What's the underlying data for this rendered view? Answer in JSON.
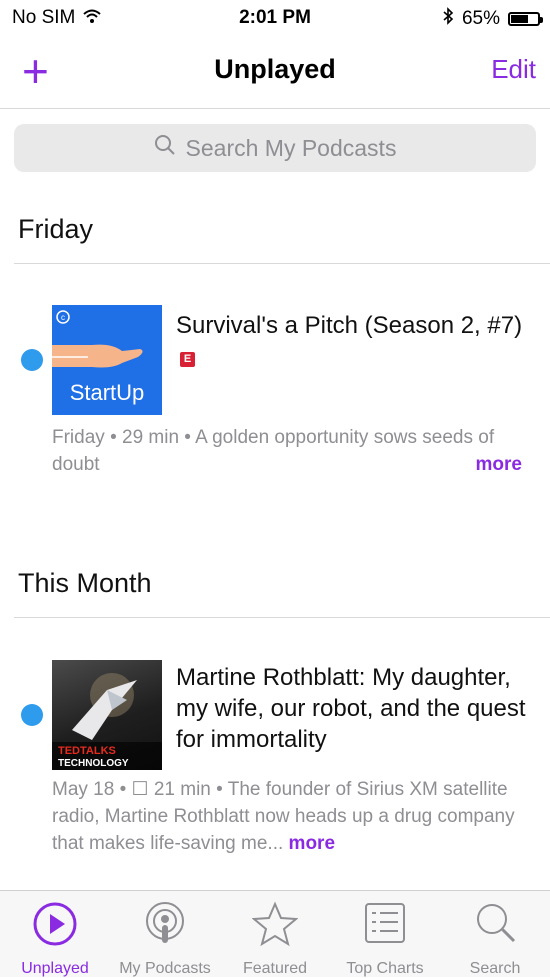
{
  "status_bar": {
    "carrier": "No SIM",
    "time": "2:01 PM",
    "battery_percent": "65%",
    "battery_level": 0.65
  },
  "nav": {
    "add_label": "+",
    "title": "Unplayed",
    "edit_label": "Edit"
  },
  "search": {
    "placeholder": "Search My Podcasts"
  },
  "sections": [
    {
      "title": "Friday",
      "episode": {
        "title": "Survival's a Pitch (Season 2, #7)",
        "explicit_badge": "E",
        "artwork_text": "StartUp",
        "artwork_logo": "©",
        "meta_prefix": "Friday • 29 min • A golden opportunity sows seeds of doubt",
        "more_label": "more"
      }
    },
    {
      "title": "This Month",
      "episode": {
        "title": "Martine Rothblatt: My daughter, my wife, our robot, and the quest for immortality",
        "artwork_text_line1": "TEDTALKS",
        "artwork_text_line2": "TECHNOLOGY",
        "meta_prefix": "May 18 • ☐ 21 min • The founder of Sirius XM satellite radio, Martine Rothblatt now heads up a drug company that makes life-saving me...",
        "more_label": "more"
      }
    }
  ],
  "tabs": [
    {
      "label": "Unplayed",
      "icon": "play-circle-icon",
      "active": true
    },
    {
      "label": "My Podcasts",
      "icon": "podcast-icon",
      "active": false
    },
    {
      "label": "Featured",
      "icon": "star-icon",
      "active": false
    },
    {
      "label": "Top Charts",
      "icon": "list-icon",
      "active": false
    },
    {
      "label": "Search",
      "icon": "search-icon",
      "active": false
    }
  ],
  "colors": {
    "accent": "#8a2be2",
    "unplayed_dot": "#2f9bec",
    "explicit": "#d82134"
  }
}
